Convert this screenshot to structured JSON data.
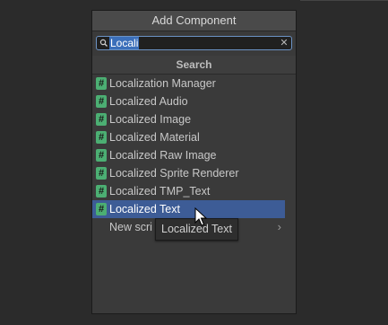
{
  "panel": {
    "title": "Add Component",
    "search": {
      "value": "Locali"
    },
    "section_title": "Search",
    "items": [
      {
        "label": "Localization Manager",
        "icon": "script-hash-icon"
      },
      {
        "label": "Localized Audio",
        "icon": "script-hash-icon"
      },
      {
        "label": "Localized Image",
        "icon": "script-hash-icon"
      },
      {
        "label": "Localized Material",
        "icon": "script-hash-icon"
      },
      {
        "label": "Localized Raw Image",
        "icon": "script-hash-icon"
      },
      {
        "label": "Localized Sprite Renderer",
        "icon": "script-hash-icon"
      },
      {
        "label": "Localized TMP_Text",
        "icon": "script-hash-icon"
      },
      {
        "label": "Localized Text",
        "icon": "script-hash-icon",
        "selected": true
      }
    ],
    "new_script_label": "New scri",
    "hash_glyph": "#"
  },
  "tooltip": {
    "text": "Localized Text"
  },
  "colors": {
    "accent": "#3d5c96",
    "script_icon": "#4caf73",
    "panel_bg": "#3a3a3a",
    "background": "#2b2b2b"
  }
}
